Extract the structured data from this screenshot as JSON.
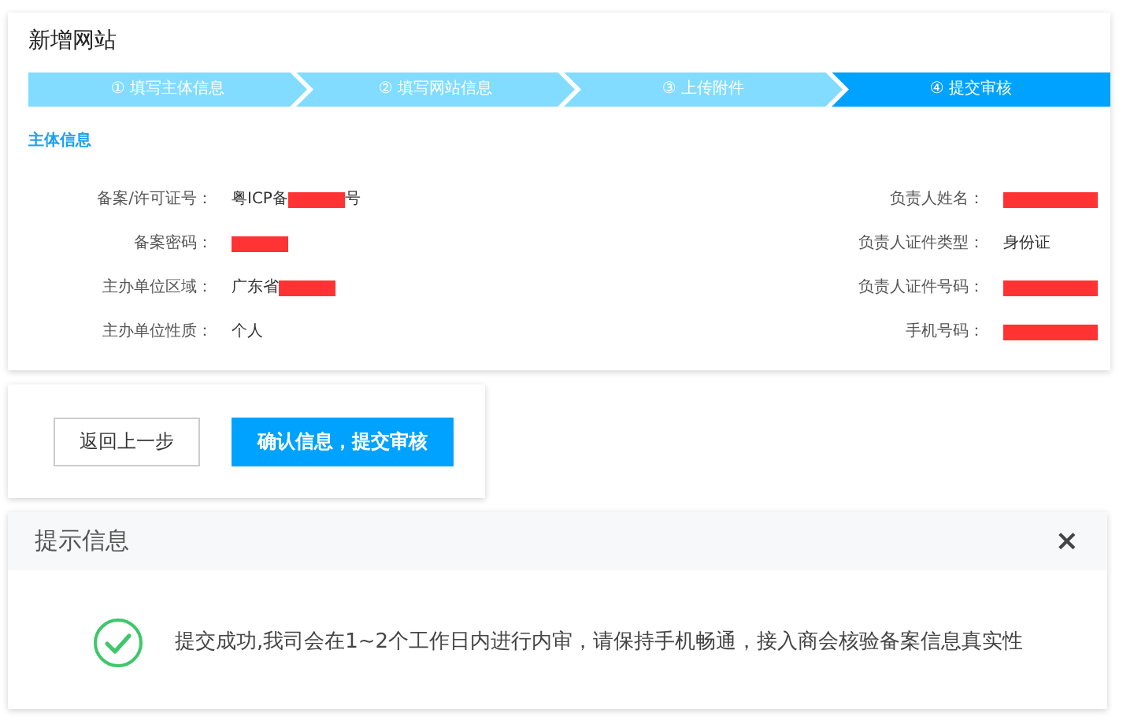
{
  "title": "新增网站",
  "steps": [
    {
      "label": "① 填写主体信息",
      "selected": false
    },
    {
      "label": "② 填写网站信息",
      "selected": false
    },
    {
      "label": "③ 上传附件",
      "selected": false
    },
    {
      "label": "④ 提交审核",
      "selected": true
    }
  ],
  "section_title": "主体信息",
  "left_fields": [
    {
      "label": "备案/许可证号：",
      "parts": [
        {
          "kind": "text",
          "text": "粤ICP备"
        },
        {
          "kind": "redacted"
        },
        {
          "kind": "text",
          "text": "号"
        }
      ]
    },
    {
      "label": "备案密码：",
      "parts": [
        {
          "kind": "redacted"
        }
      ]
    },
    {
      "label": "主办单位区域：",
      "parts": [
        {
          "kind": "text",
          "text": "广东省"
        },
        {
          "kind": "redacted"
        }
      ]
    },
    {
      "label": "主办单位性质：",
      "parts": [
        {
          "kind": "text",
          "text": "个人"
        }
      ]
    }
  ],
  "right_fields": [
    {
      "label": "负责人姓名：",
      "parts": [
        {
          "kind": "redacted"
        }
      ]
    },
    {
      "label": "负责人证件类型：",
      "parts": [
        {
          "kind": "text",
          "text": "身份证"
        }
      ]
    },
    {
      "label": "负责人证件号码：",
      "parts": [
        {
          "kind": "redacted"
        }
      ]
    },
    {
      "label": "手机号码：",
      "parts": [
        {
          "kind": "redacted"
        }
      ]
    }
  ],
  "buttons": [
    {
      "label": "返回上一步",
      "kind": "secondary"
    },
    {
      "label": "确认信息，提交审核",
      "kind": "primary"
    }
  ],
  "dialog": {
    "title": "提示信息",
    "close": "×",
    "message": "提交成功,我司会在1~2个工作日内进行内审，请保持手机畅通，接入商会核验备案信息真实性"
  }
}
